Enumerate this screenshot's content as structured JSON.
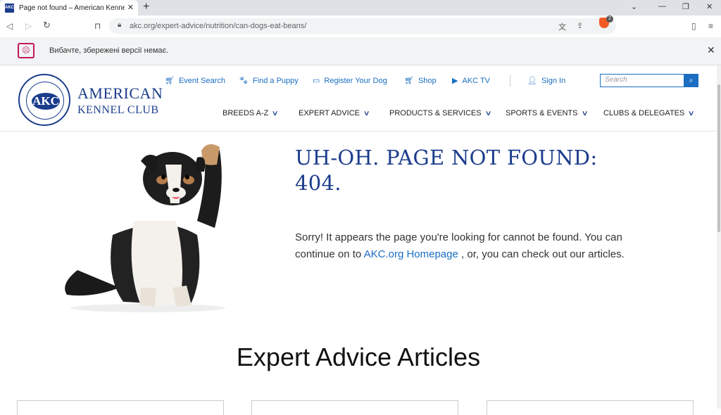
{
  "browser": {
    "tab_title": "Page not found – American Kennel Club",
    "favicon_text": "AKC",
    "url": "akc.org/expert-advice/nutrition/can-dogs-eat-beans/",
    "infobar_text": "Вибачте, збережені версії немає."
  },
  "header": {
    "logo_line1": "AMERICAN",
    "logo_line2": "KENNEL CLUB",
    "logo_monogram": "AKC",
    "utility_links": [
      {
        "label": "Event Search",
        "icon": "cart-calendar-icon"
      },
      {
        "label": "Find a Puppy",
        "icon": "paw-icon"
      },
      {
        "label": "Register Your Dog",
        "icon": "certificate-icon"
      },
      {
        "label": "Shop",
        "icon": "cart-icon"
      },
      {
        "label": "AKC TV",
        "icon": "play-icon"
      },
      {
        "label": "Sign In",
        "icon": "user-icon"
      }
    ],
    "search_placeholder": "Search",
    "main_nav": [
      {
        "label": "BREEDS A-Z"
      },
      {
        "label": "EXPERT ADVICE"
      },
      {
        "label": "PRODUCTS & SERVICES"
      },
      {
        "label": "SPORTS & EVENTS"
      },
      {
        "label": "CLUBS & DELEGATES"
      }
    ]
  },
  "error": {
    "headline": "UH-OH. PAGE NOT FOUND: 404.",
    "message_before": "Sorry! It appears the page you're looking for cannot be found. You can continue on to ",
    "homepage_link": "AKC.org Homepage",
    "message_after": " , or, you can check out our articles."
  },
  "articles": {
    "heading": "Expert Advice Articles"
  },
  "colors": {
    "brand_blue": "#1b3c8c",
    "link_blue": "#1b6ec2"
  }
}
